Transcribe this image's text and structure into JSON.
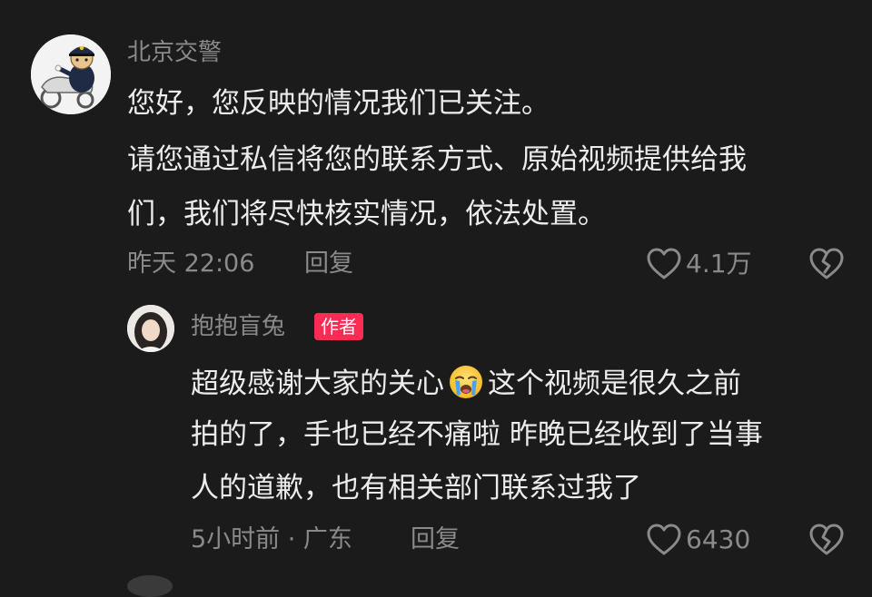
{
  "comment_1": {
    "username": "北京交警",
    "lines": [
      "您好，您反映的情况我们已关注。",
      "请您通过私信将您的联系方式、原始视频提供给我",
      "们，我们将尽快核实情况，依法处置。"
    ],
    "time": "昨天 22:06",
    "reply_label": "回复",
    "like_count": "4.1万"
  },
  "comment_2": {
    "username": "抱抱盲兔",
    "author_badge": "作者",
    "line_1_before_emoji": "超级感谢大家的关心",
    "emoji": "crying-face",
    "line_1_after_emoji": "这个视频是很久之前",
    "line_2": "拍的了，手也已经不痛啦 昨晚已经收到了当事",
    "line_3": "人的道歉，也有相关部门联系过我了",
    "time_location": "5小时前 · 广东",
    "reply_label": "回复",
    "like_count": "6430"
  },
  "colors": {
    "background": "#1b1b1b",
    "primary_text": "#ececec",
    "secondary_text": "#8a8a8a",
    "author_badge": "#fe2c55"
  }
}
